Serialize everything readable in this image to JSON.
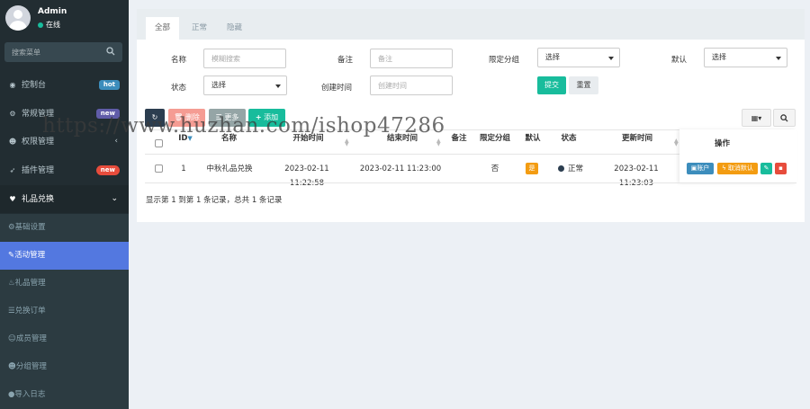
{
  "user": {
    "name": "Admin",
    "status": "在线"
  },
  "sidebar": {
    "search_placeholder": "搜索菜单",
    "items": [
      {
        "label": "控制台",
        "badge": "hot"
      },
      {
        "label": "常规管理",
        "badge": "new"
      },
      {
        "label": "权限管理"
      },
      {
        "label": "插件管理",
        "badge": "new"
      },
      {
        "label": "礼品兑换"
      }
    ],
    "subitems": [
      {
        "label": "基础设置"
      },
      {
        "label": "活动管理"
      },
      {
        "label": "礼品管理"
      },
      {
        "label": "兑换订单"
      },
      {
        "label": "成员管理"
      },
      {
        "label": "分组管理"
      },
      {
        "label": "导入日志"
      }
    ]
  },
  "tabs": [
    "全部",
    "正常",
    "隐藏"
  ],
  "filters": {
    "name_label": "名称",
    "name_placeholder": "模糊搜索",
    "remark_label": "备注",
    "remark_placeholder": "备注",
    "group_label": "限定分组",
    "group_value": "选择",
    "default_label": "默认",
    "default_value": "选择",
    "status_label": "状态",
    "status_value": "选择",
    "created_label": "创建时间",
    "created_placeholder": "创建时间",
    "submit": "提交",
    "reset": "重置"
  },
  "toolbar": {
    "delete": "删除",
    "more": "更多",
    "add": "添加"
  },
  "table": {
    "headers": [
      "ID",
      "名称",
      "开始时间",
      "结束时间",
      "备注",
      "限定分组",
      "默认",
      "状态",
      "更新时间",
      "操作"
    ],
    "row": {
      "id": "1",
      "name": "中秋礼品兑换",
      "start": "2023-02-11 11:22:58",
      "end": "2023-02-11 11:23:00",
      "remark": "",
      "group": "否",
      "default": "是",
      "status": "正常",
      "updated": "2023-02-11 11:23:03",
      "ops": {
        "account": "账户",
        "cancel_default": "取消默认"
      }
    },
    "footer": "显示第 1 到第 1 条记录，总共 1 条记录"
  },
  "watermark": "https://www.huzhan.com/ishop47286",
  "colors": {
    "sidebar": "#222d32",
    "active": "#5378e0",
    "primary": "#18bc9c"
  }
}
